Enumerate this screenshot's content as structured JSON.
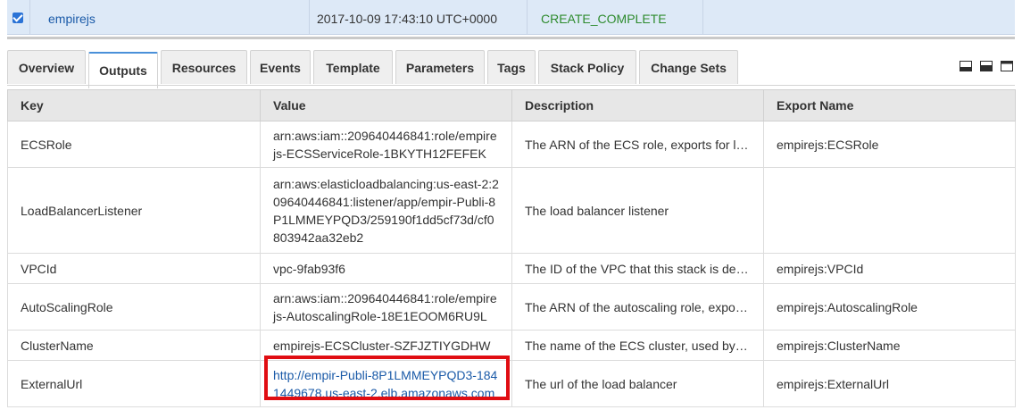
{
  "stack": {
    "name": "empirejs",
    "created": "2017-10-09 17:43:10 UTC+0000",
    "status": "CREATE_COMPLETE"
  },
  "tabs": [
    {
      "label": "Overview"
    },
    {
      "label": "Outputs"
    },
    {
      "label": "Resources"
    },
    {
      "label": "Events"
    },
    {
      "label": "Template"
    },
    {
      "label": "Parameters"
    },
    {
      "label": "Tags"
    },
    {
      "label": "Stack Policy"
    },
    {
      "label": "Change Sets"
    }
  ],
  "active_tab": "Outputs",
  "table": {
    "headers": {
      "key": "Key",
      "value": "Value",
      "description": "Description",
      "export": "Export Name"
    },
    "rows": [
      {
        "key": "ECSRole",
        "value": "arn:aws:iam::209640446841:role/empirejs-ECSServiceRole-1BKYTH12FEFEK",
        "description": "The ARN of the ECS role, exports for la...",
        "export": "empirejs:ECSRole"
      },
      {
        "key": "LoadBalancerListener",
        "value": "arn:aws:elasticloadbalancing:us-east-2:209640446841:listener/app/empir-Publi-8P1LMMEYPQD3/259190f1dd5cf73d/cf0803942aa32eb2",
        "description": "The load balancer listener",
        "export": ""
      },
      {
        "key": "VPCId",
        "value": "vpc-9fab93f6",
        "description": "The ID of the VPC that this stack is dep...",
        "export": "empirejs:VPCId"
      },
      {
        "key": "AutoScalingRole",
        "value": "arn:aws:iam::209640446841:role/empirejs-AutoscalingRole-18E1EOOM6RU9L",
        "description": "The ARN of the autoscaling role, export...",
        "export": "empirejs:AutoscalingRole"
      },
      {
        "key": "ClusterName",
        "value": "empirejs-ECSCluster-SZFJZTIYGDHW",
        "description": "The name of the ECS cluster, used by t...",
        "export": "empirejs:ClusterName"
      },
      {
        "key": "ExternalUrl",
        "value": "http://empir-Publi-8P1LMMEYPQD3-1841449678.us-east-2.elb.amazonaws.com",
        "description": "The url of the load balancer",
        "export": "empirejs:ExternalUrl"
      }
    ]
  }
}
